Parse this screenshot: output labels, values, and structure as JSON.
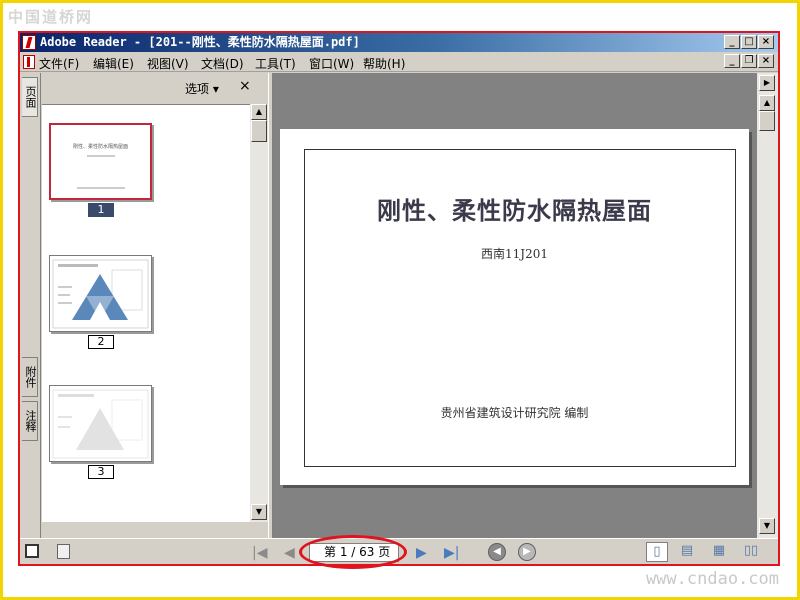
{
  "watermarks": {
    "top": "中国道桥网",
    "bottom": "www.cndao.com"
  },
  "window": {
    "title": "Adobe Reader - [201--刚性、柔性防水隔热屋面.pdf]"
  },
  "menu": [
    {
      "label": "文件(F)"
    },
    {
      "label": "编辑(E)"
    },
    {
      "label": "视图(V)"
    },
    {
      "label": "文档(D)"
    },
    {
      "label": "工具(T)"
    },
    {
      "label": "窗口(W)"
    },
    {
      "label": "帮助(H)"
    }
  ],
  "side_tabs": {
    "pages": "页面",
    "attachments": "附件",
    "comments": "注释"
  },
  "panel": {
    "options": "选项 ▾",
    "close": "×"
  },
  "thumbnails": [
    {
      "label": "1",
      "title": "刚性、柔性防水隔热屋面"
    },
    {
      "label": "2"
    },
    {
      "label": "3"
    }
  ],
  "page": {
    "title": "刚性、柔性防水隔热屋面",
    "subtitle": "西南11J201",
    "footer": "贵州省建筑设计研究院  编制"
  },
  "status": {
    "page_indicator": "第 1 / 63 页"
  },
  "colors": {
    "highlight": "#e0141e",
    "frame": "#f2d400",
    "titlebar": "#0a246a"
  }
}
